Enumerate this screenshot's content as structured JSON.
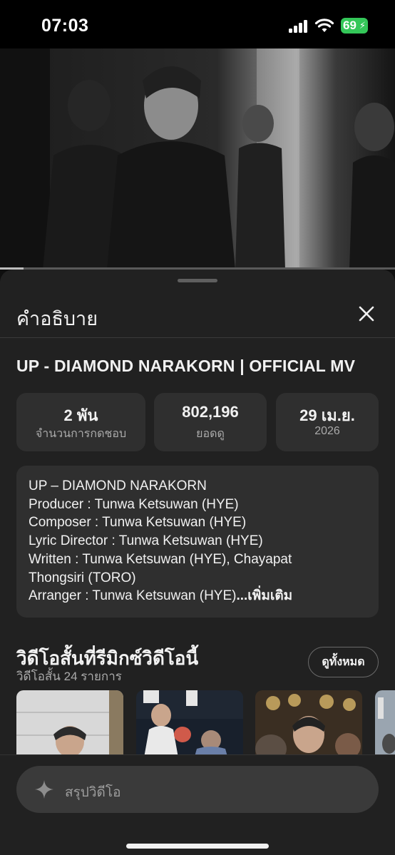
{
  "status_bar": {
    "time": "07:03",
    "battery": "69"
  },
  "video": {
    "progress": 0.06
  },
  "panel": {
    "title": "คำอธิบาย",
    "video_title": "UP - DIAMOND NARAKORN | OFFICIAL MV",
    "stats": [
      {
        "value": "2 พัน",
        "label": "จำนวนการกดชอบ"
      },
      {
        "value": "802,196",
        "label": "ยอดดู"
      },
      {
        "value": "29 เม.ย.",
        "label": "2026"
      }
    ],
    "description": {
      "lines": [
        "UP – DIAMOND NARAKORN",
        "Producer : Tunwa Ketsuwan (HYE)",
        "Composer : Tunwa Ketsuwan (HYE)",
        "Lyric Director : Tunwa Ketsuwan (HYE)",
        "Written : Tunwa Ketsuwan (HYE), Chayapat",
        "Thongsiri (TORO)",
        "Arranger : Tunwa Ketsuwan (HYE)"
      ],
      "more": "...เพิ่มเติม"
    },
    "remix_section": {
      "title": "วิดีโอสั้นที่รีมิกซ์วิดีโอนี้",
      "subtitle": "วิดีโอสั้น 24 รายการ",
      "view_all": "ดูทั้งหมด"
    }
  },
  "summary_input": {
    "placeholder": "สรุปวิดีโอ"
  },
  "colors": {
    "background": "#0f0f0f",
    "panel": "#212121",
    "card": "#2f2f2f",
    "battery": "#34c759"
  },
  "icons": [
    "signal-icon",
    "wifi-icon",
    "battery-icon",
    "close-icon",
    "sparkle-icon"
  ]
}
